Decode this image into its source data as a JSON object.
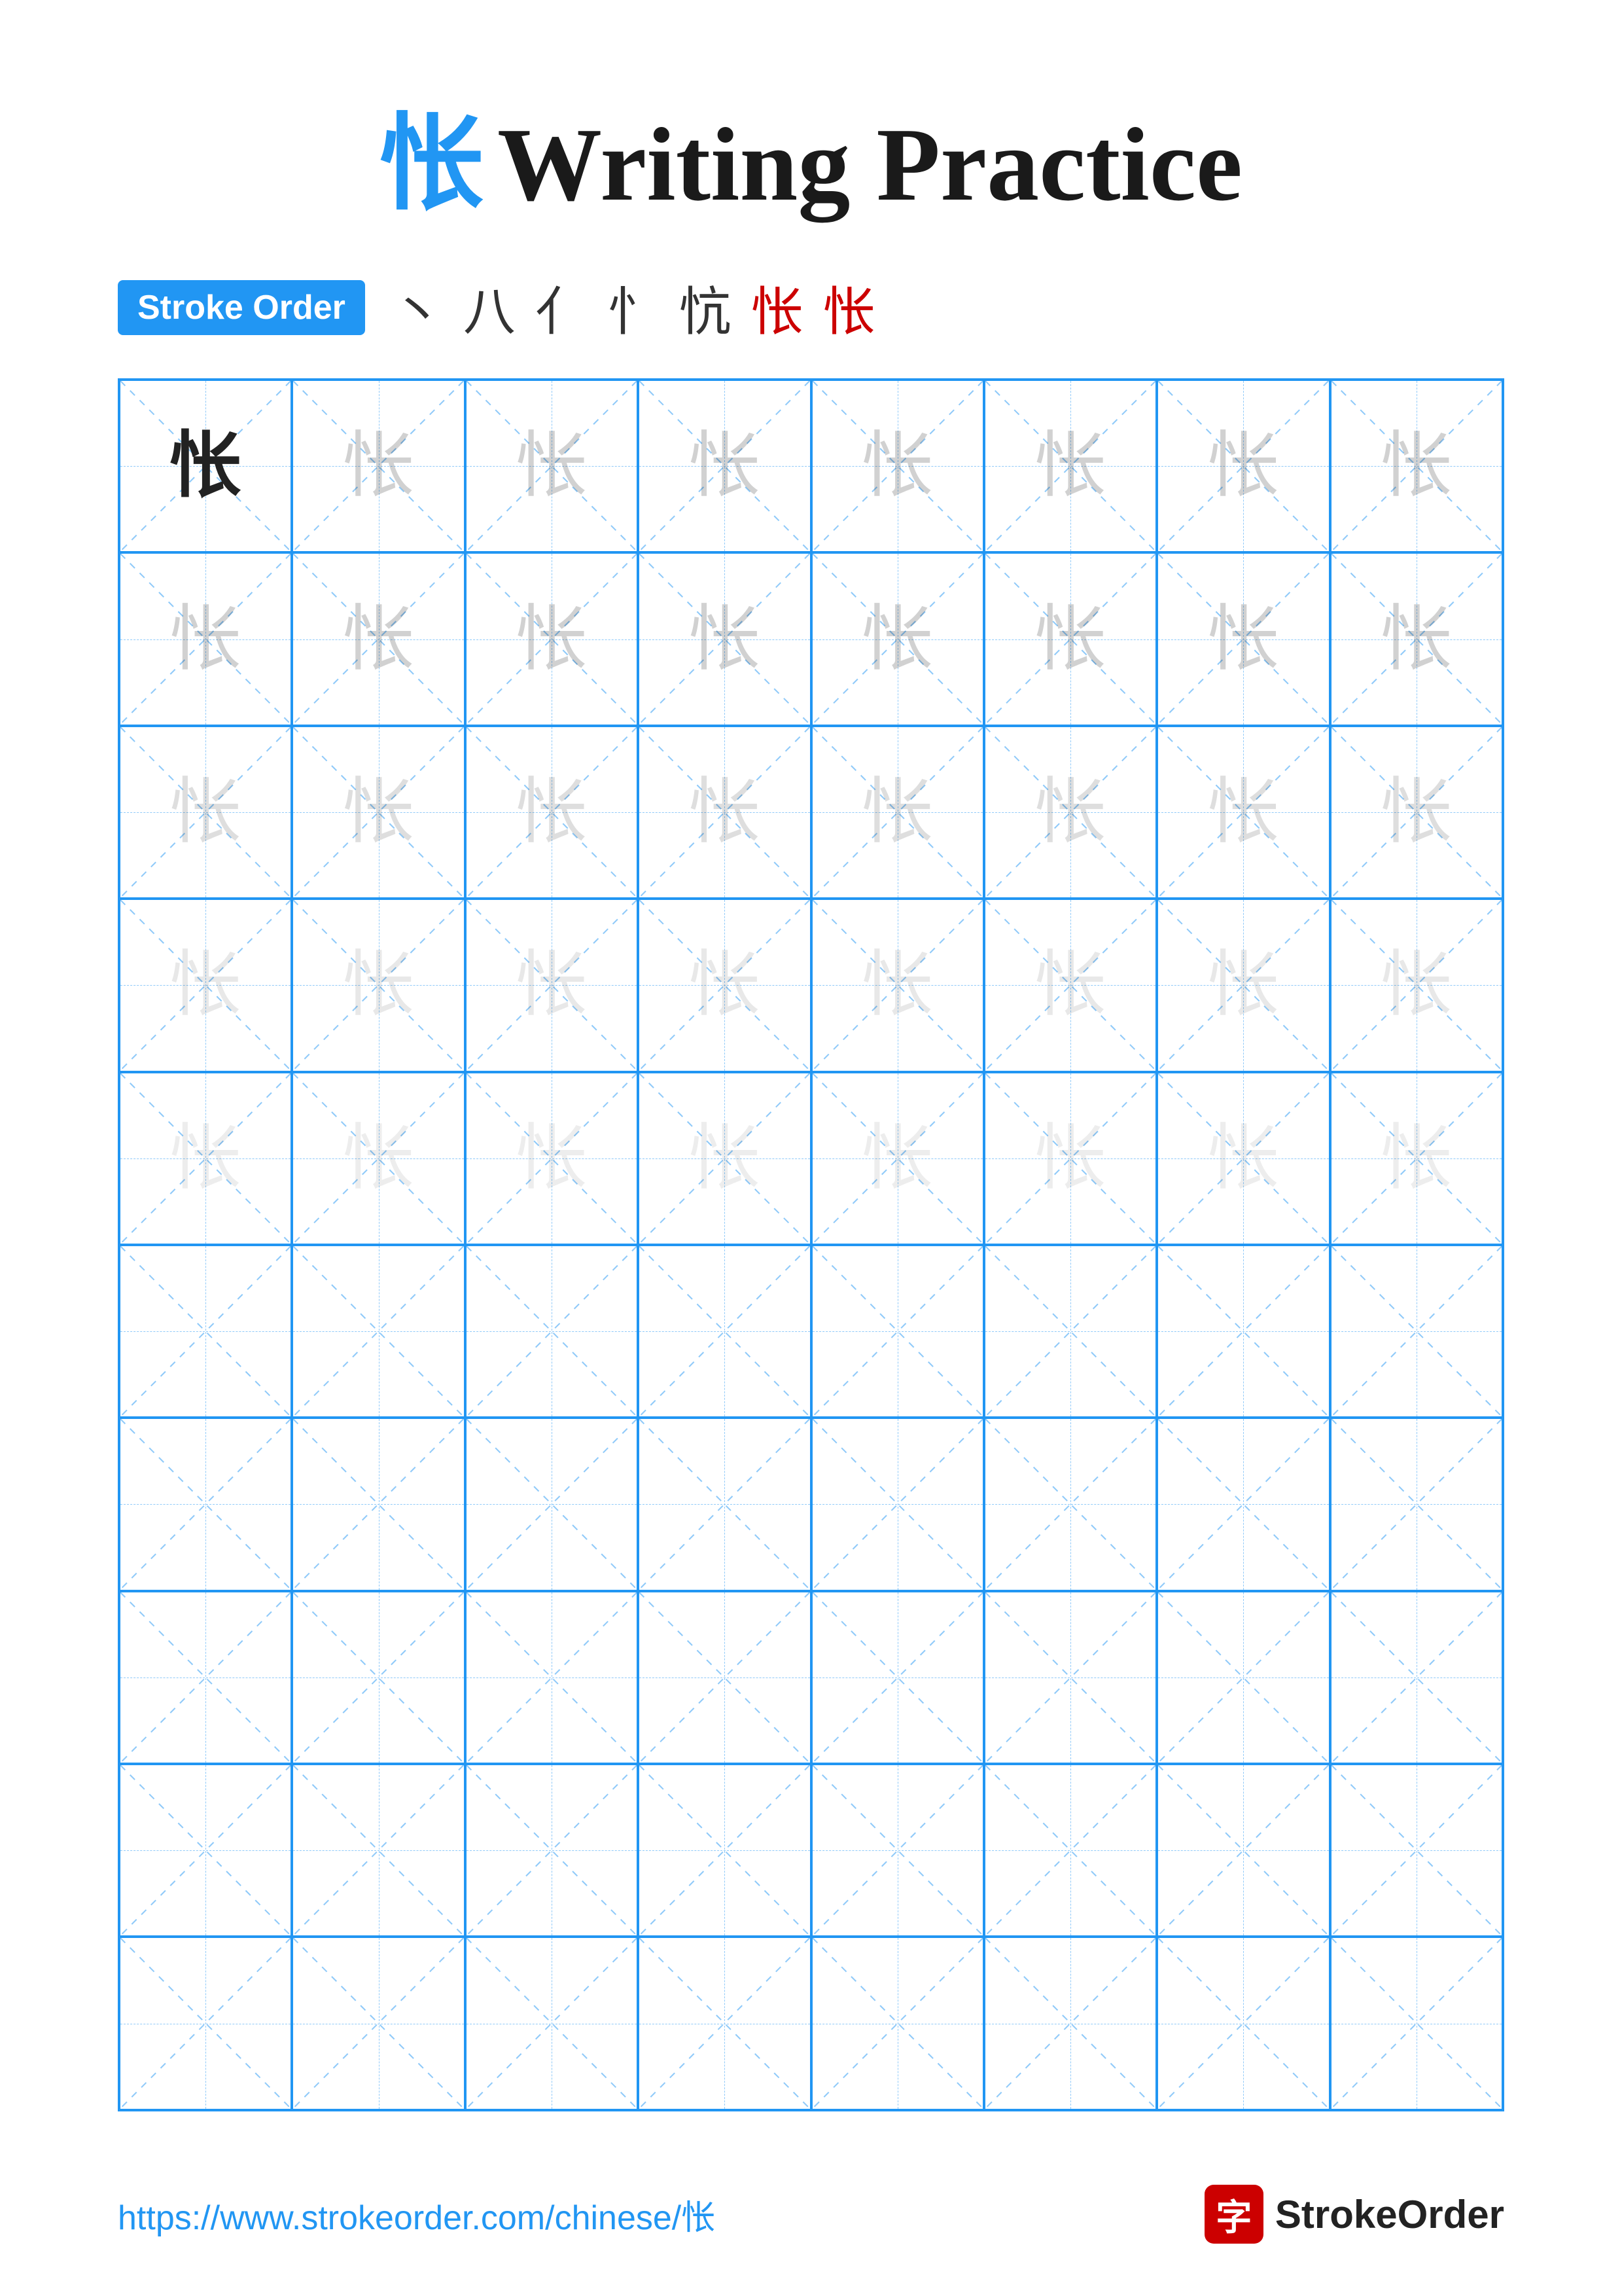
{
  "page": {
    "title": {
      "chinese_char": "怅",
      "english_text": "Writing Practice"
    },
    "stroke_order": {
      "badge_label": "Stroke Order",
      "strokes": [
        "丶",
        "八",
        "亻",
        "忄",
        "忼",
        "怅",
        "怅"
      ]
    },
    "grid": {
      "cols": 8,
      "rows": 10,
      "practice_char": "怅",
      "filled_rows": 5,
      "char_opacities": [
        "dark",
        "light1",
        "light1",
        "light1",
        "light1",
        "light1",
        "light1",
        "light1",
        "light2",
        "light2",
        "light2",
        "light2",
        "light2",
        "light2",
        "light2",
        "light2",
        "light3",
        "light3",
        "light3",
        "light3",
        "light3",
        "light3",
        "light3",
        "light3",
        "light4",
        "light4",
        "light4",
        "light4",
        "light4",
        "light4",
        "light4",
        "light4",
        "light4",
        "light4",
        "light4",
        "light4",
        "light4",
        "light4",
        "light4",
        "light4"
      ]
    },
    "footer": {
      "url": "https://www.strokeorder.com/chinese/怅",
      "brand_char": "字",
      "brand_name": "StrokeOrder"
    }
  }
}
